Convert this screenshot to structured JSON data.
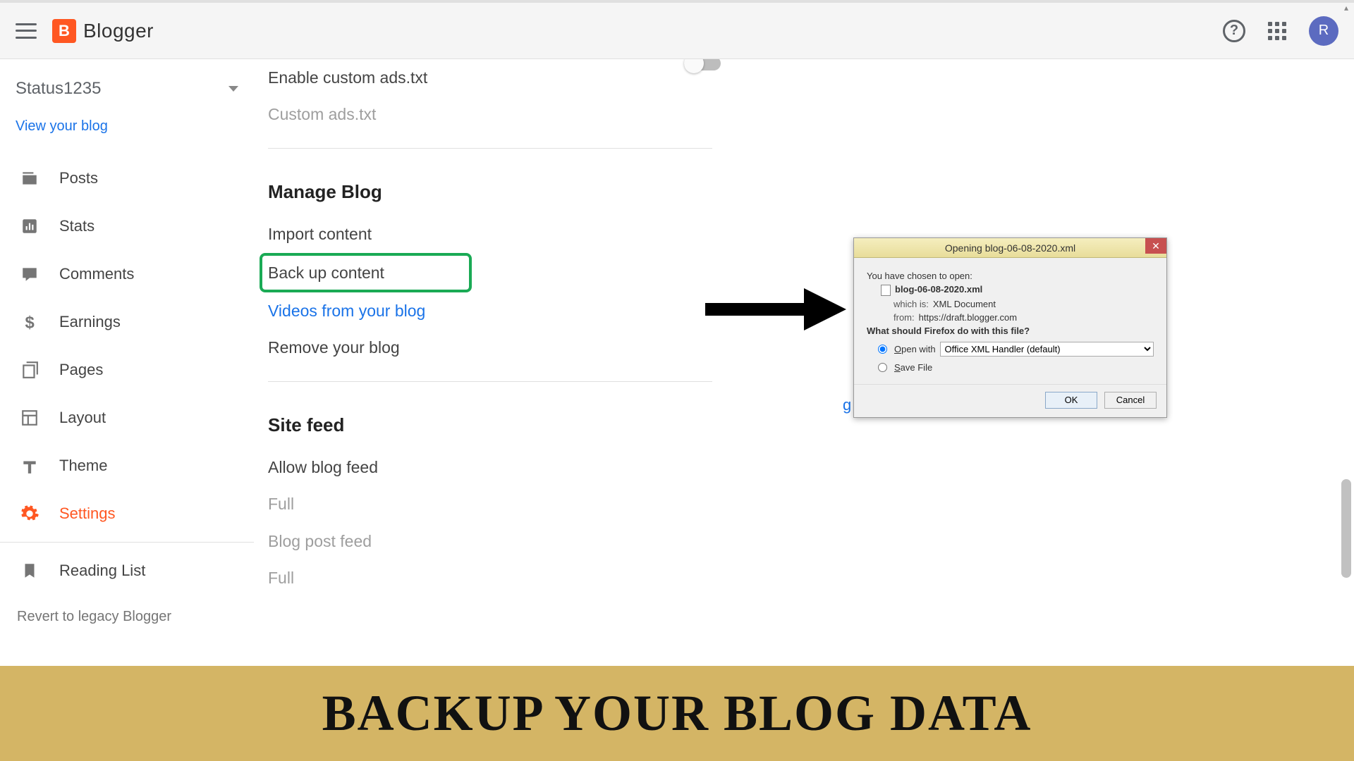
{
  "header": {
    "brand": "Blogger",
    "avatar_initial": "R"
  },
  "sidebar": {
    "blog_name": "Status1235",
    "view_link": "View your blog",
    "items": [
      {
        "label": "Posts"
      },
      {
        "label": "Stats"
      },
      {
        "label": "Comments"
      },
      {
        "label": "Earnings"
      },
      {
        "label": "Pages"
      },
      {
        "label": "Layout"
      },
      {
        "label": "Theme"
      },
      {
        "label": "Settings"
      }
    ],
    "reading_list": "Reading List",
    "revert": "Revert to legacy Blogger"
  },
  "settings": {
    "ads_toggle_label": "Enable custom ads.txt",
    "ads_custom": "Custom ads.txt",
    "manage_head": "Manage Blog",
    "import": "Import content",
    "backup": "Back up content",
    "videos": "Videos from your blog",
    "remove": "Remove your blog",
    "feed_head": "Site feed",
    "allow_feed": "Allow blog feed",
    "allow_feed_val": "Full",
    "post_feed": "Blog post feed",
    "post_feed_val": "Full",
    "g_fragment": "g"
  },
  "dialog": {
    "title": "Opening blog-06-08-2020.xml",
    "chosen": "You have chosen to open:",
    "filename": "blog-06-08-2020.xml",
    "which_lbl": "which is:",
    "which_val": "XML Document",
    "from_lbl": "from:",
    "from_val": "https://draft.blogger.com",
    "question": "What should Firefox do with this file?",
    "open_pre": "O",
    "open_with": "pen with",
    "open_app": "Office XML Handler (default)",
    "save_pre": "S",
    "save_file": "ave File",
    "ok": "OK",
    "cancel": "Cancel"
  },
  "banner": {
    "text": "BACKUP YOUR BLOG DATA"
  }
}
